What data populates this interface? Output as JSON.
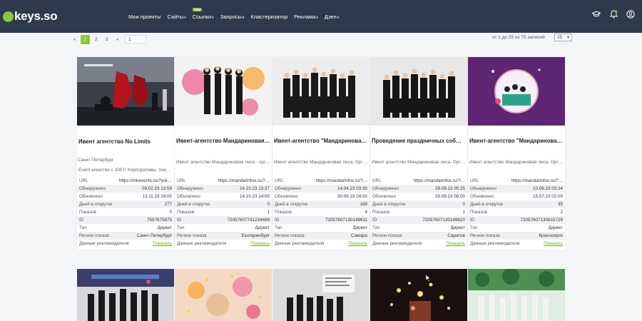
{
  "brand": {
    "logo_text": "keys.so",
    "accent": "#8dc63f",
    "topbar_bg": "#2d3a4d"
  },
  "nav": {
    "items": [
      {
        "label": "Мои проекты",
        "caret": ""
      },
      {
        "label": "Сайты",
        "caret": "▾"
      },
      {
        "label": "Ссылки",
        "caret": "▾",
        "badge": "new"
      },
      {
        "label": "Запросы",
        "caret": "▾"
      },
      {
        "label": "Кластеризатор",
        "caret": ""
      },
      {
        "label": "Реклама",
        "caret": "▾"
      },
      {
        "label": "Дзен",
        "caret": "▾"
      }
    ],
    "icons": [
      "graduation-cap-icon",
      "bell-icon",
      "user-icon"
    ]
  },
  "pagination": {
    "prev": "«",
    "pages": [
      "1",
      "2",
      "3"
    ],
    "active": "1",
    "next": "»",
    "jump_value": "1",
    "records": "от 1 до 25 из 75 записей",
    "per_page": "25"
  },
  "labels": {
    "url": "URL",
    "found": "Обнаружено",
    "updated": "Обновлено",
    "days": "Дней в открутке",
    "shows": "Показов",
    "id": "ID",
    "type": "Тип",
    "region": "Регион показа",
    "advertiser": "Данные рекламодателя",
    "show_link": "Показать"
  },
  "cards": [
    {
      "title": "Ивент агентство No Limits",
      "desc": "Event агенство с 2007г Корпоративы, тимбилд…",
      "location": "Санкт-Петербург",
      "url": "https://mirevents.ru/?ycli…",
      "found": "09.02.23 13:59",
      "updated": "13.11.23 16:00",
      "days": "277",
      "shows": "5",
      "id": "7557675875",
      "type": "Директ",
      "region": "Санкт-Петербург",
      "image": "tango-show-photo"
    },
    {
      "title": "Ивент-агентство Мандариновая Лиса",
      "desc": "Ивент агентство Мандариновая лиса - органи…",
      "location": "",
      "url": "https://mandarinfox.ru/?…",
      "found": "14.10.23 13:37",
      "updated": "14.10.23 14:00",
      "days": "0",
      "shows": "1",
      "id": "72057607741234488",
      "type": "Директ",
      "region": "Екатеринбург",
      "image": "dancers-paint-photo"
    },
    {
      "title": "Ивент-агентство \"Мандариновая Лис…",
      "desc": "Ивент агентство Мандариновая лиса. Органи…",
      "location": "",
      "url": "https://mandarinfox.ru/?…",
      "found": "14.04.23 03:30",
      "updated": "30.09.23 04:00",
      "days": "169",
      "shows": "4",
      "id": "72057607130149611",
      "type": "Директ",
      "region": "Самара",
      "image": "group-photo"
    },
    {
      "title": "Проведение праздничных событий с…",
      "desc": "Ивент агентство Мандариновая лиса. Органи…",
      "location": "",
      "url": "https://mandarinfox.ru/?…",
      "found": "29.09.23 05:25",
      "updated": "29.09.23 06:00",
      "days": "0",
      "shows": "1",
      "id": "72057607130149620",
      "type": "Директ",
      "region": "Саратов",
      "image": "group-photo-2"
    },
    {
      "title": "Ивент-агентство \"Мандариновая Лис…",
      "desc": "Ивент агентство Мандариновая лиса. Органи…",
      "location": "",
      "url": "https://mandarinfox.ru/?…",
      "found": "10.06.23 03:24",
      "updated": "15.07.23 02:00",
      "days": "35",
      "shows": "2",
      "id": "72057607130815729",
      "type": "Директ",
      "region": "Красноярск",
      "image": "purple-collage"
    }
  ],
  "cards2": [
    "dancers-row-photo",
    "confetti-photo",
    "event-notes-photo",
    "fireworks-photo",
    "crowd-photo"
  ]
}
